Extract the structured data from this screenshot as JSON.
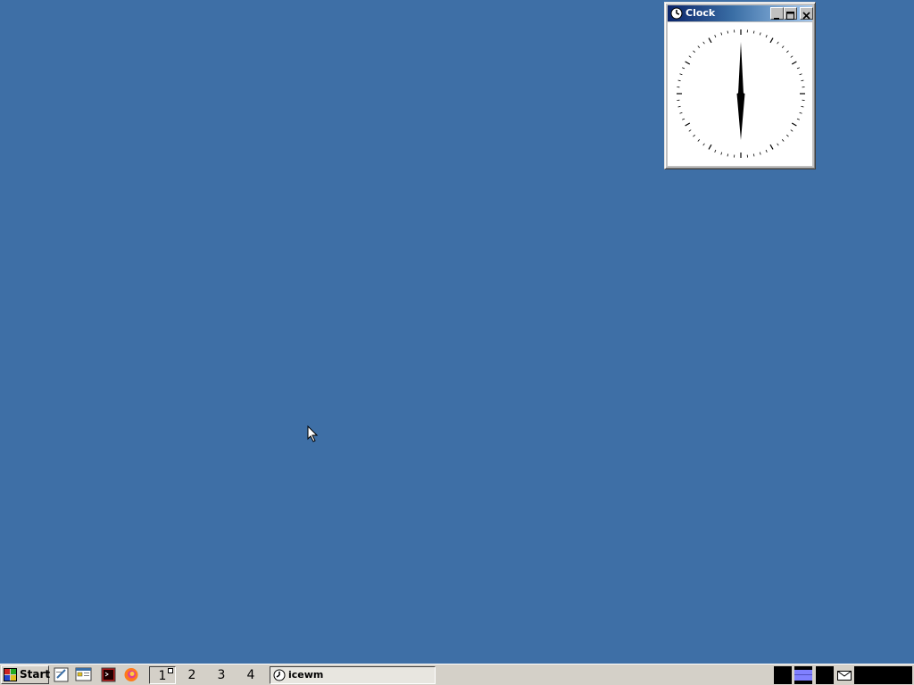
{
  "clock_window": {
    "title": "Clock",
    "icon": "clock-icon",
    "buttons": [
      "minimize",
      "maximize",
      "close"
    ],
    "time": {
      "hour": 6,
      "minute": 0
    }
  },
  "taskbar": {
    "start_label": "Start",
    "quick_launch": [
      "editor-icon",
      "file-manager-icon",
      "terminal-icon",
      "browser-icon"
    ],
    "workspaces": [
      {
        "label": "1",
        "active": true
      },
      {
        "label": "2",
        "active": false
      },
      {
        "label": "3",
        "active": false
      },
      {
        "label": "4",
        "active": false
      }
    ],
    "tasks": [
      {
        "label": "icewm",
        "icon": "clock-icon"
      }
    ],
    "tray": [
      "cpu-monitor",
      "network-monitor",
      "memory-monitor",
      "mail-icon",
      "clock-display"
    ]
  },
  "colors": {
    "desktop": "#3e6fa6",
    "taskbar": "#d4d0c8",
    "titlebar_active": "#0a246a",
    "net_monitor": "#8080ff"
  }
}
